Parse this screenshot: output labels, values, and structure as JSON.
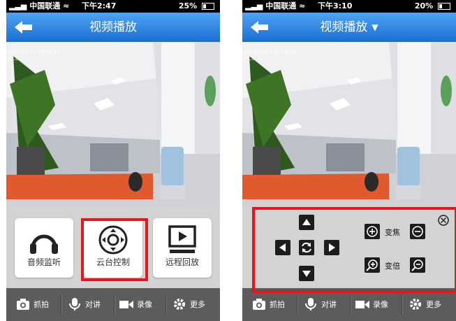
{
  "left": {
    "status": {
      "carrier": "中国联通",
      "time": "下午2:47",
      "battery": "25%"
    },
    "nav": {
      "title": "视频播放"
    },
    "video": {
      "timestamp": "2013-03-14 14:42:34",
      "channel": "IPC0"
    },
    "function_cards": [
      {
        "label": "音频监听",
        "icon": "headphones-icon"
      },
      {
        "label": "云台控制",
        "icon": "ptz-joystick-icon"
      },
      {
        "label": "远程回放",
        "icon": "playback-monitor-icon"
      }
    ],
    "toolbar": [
      {
        "label": "抓拍",
        "icon": "camera-icon"
      },
      {
        "label": "对讲",
        "icon": "microphone-icon"
      },
      {
        "label": "录像",
        "icon": "video-record-icon"
      },
      {
        "label": "更多",
        "icon": "gear-icon"
      }
    ]
  },
  "right": {
    "status": {
      "carrier": "中国联通",
      "time": "下午3:10",
      "battery": "20%"
    },
    "nav": {
      "title": "视频播放",
      "caret": "▼"
    },
    "video": {
      "timestamp": "2013-03-14 15:08:34",
      "channel": "IPC0"
    },
    "ptz": {
      "focus_label": "变焦",
      "zoom_label": "变倍"
    },
    "toolbar": [
      {
        "label": "抓拍",
        "icon": "camera-icon"
      },
      {
        "label": "对讲",
        "icon": "microphone-icon"
      },
      {
        "label": "录像",
        "icon": "video-record-icon"
      },
      {
        "label": "更多",
        "icon": "gear-icon"
      }
    ]
  },
  "colors": {
    "nav_blue": "#2a7fe0",
    "highlight_red": "#e8151c",
    "toolbar_gray": "#5c5c5c"
  }
}
